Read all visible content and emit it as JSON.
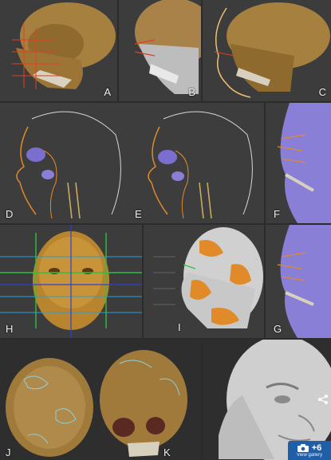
{
  "panels": {
    "a": {
      "label": "A"
    },
    "b": {
      "label": "B"
    },
    "c": {
      "label": "C"
    },
    "d": {
      "label": "D"
    },
    "e": {
      "label": "E"
    },
    "f": {
      "label": "F"
    },
    "g": {
      "label": "G"
    },
    "h": {
      "label": "H"
    },
    "i": {
      "label": "I"
    },
    "j": {
      "label": "J"
    },
    "k": {
      "label": "K"
    }
  },
  "overlay": {
    "count": "+6",
    "sub": "View gallery"
  },
  "colors": {
    "bone": "#b08a4a",
    "bone_dark": "#6b4e22",
    "gray_skull": "#b8b8b8",
    "orange": "#e08a2a",
    "purple": "#8a7fd6",
    "blue_badge": "#1f5fa8"
  }
}
